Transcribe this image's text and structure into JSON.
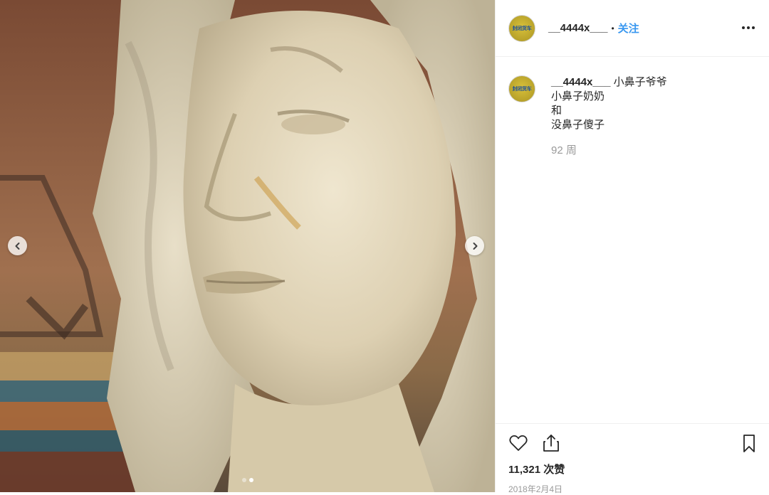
{
  "post": {
    "username": "__4444x___",
    "separator": "•",
    "follow_label": "关注",
    "avatar_text": "封闭货车",
    "more_icon": "more-options-icon"
  },
  "caption": {
    "username": "__4444x___",
    "lines": [
      "小鼻子爷爷",
      "小鼻子奶奶",
      "和",
      "没鼻子傻子"
    ],
    "time": "92 周"
  },
  "actions": {
    "like_icon": "heart-icon",
    "share_icon": "share-icon",
    "save_icon": "bookmark-icon",
    "likes": "11,321 次赞",
    "date": "2018年2月4日"
  },
  "carousel": {
    "prev_icon": "chevron-left-icon",
    "next_icon": "chevron-right-icon",
    "slide_count": 2,
    "active_slide": 2
  }
}
